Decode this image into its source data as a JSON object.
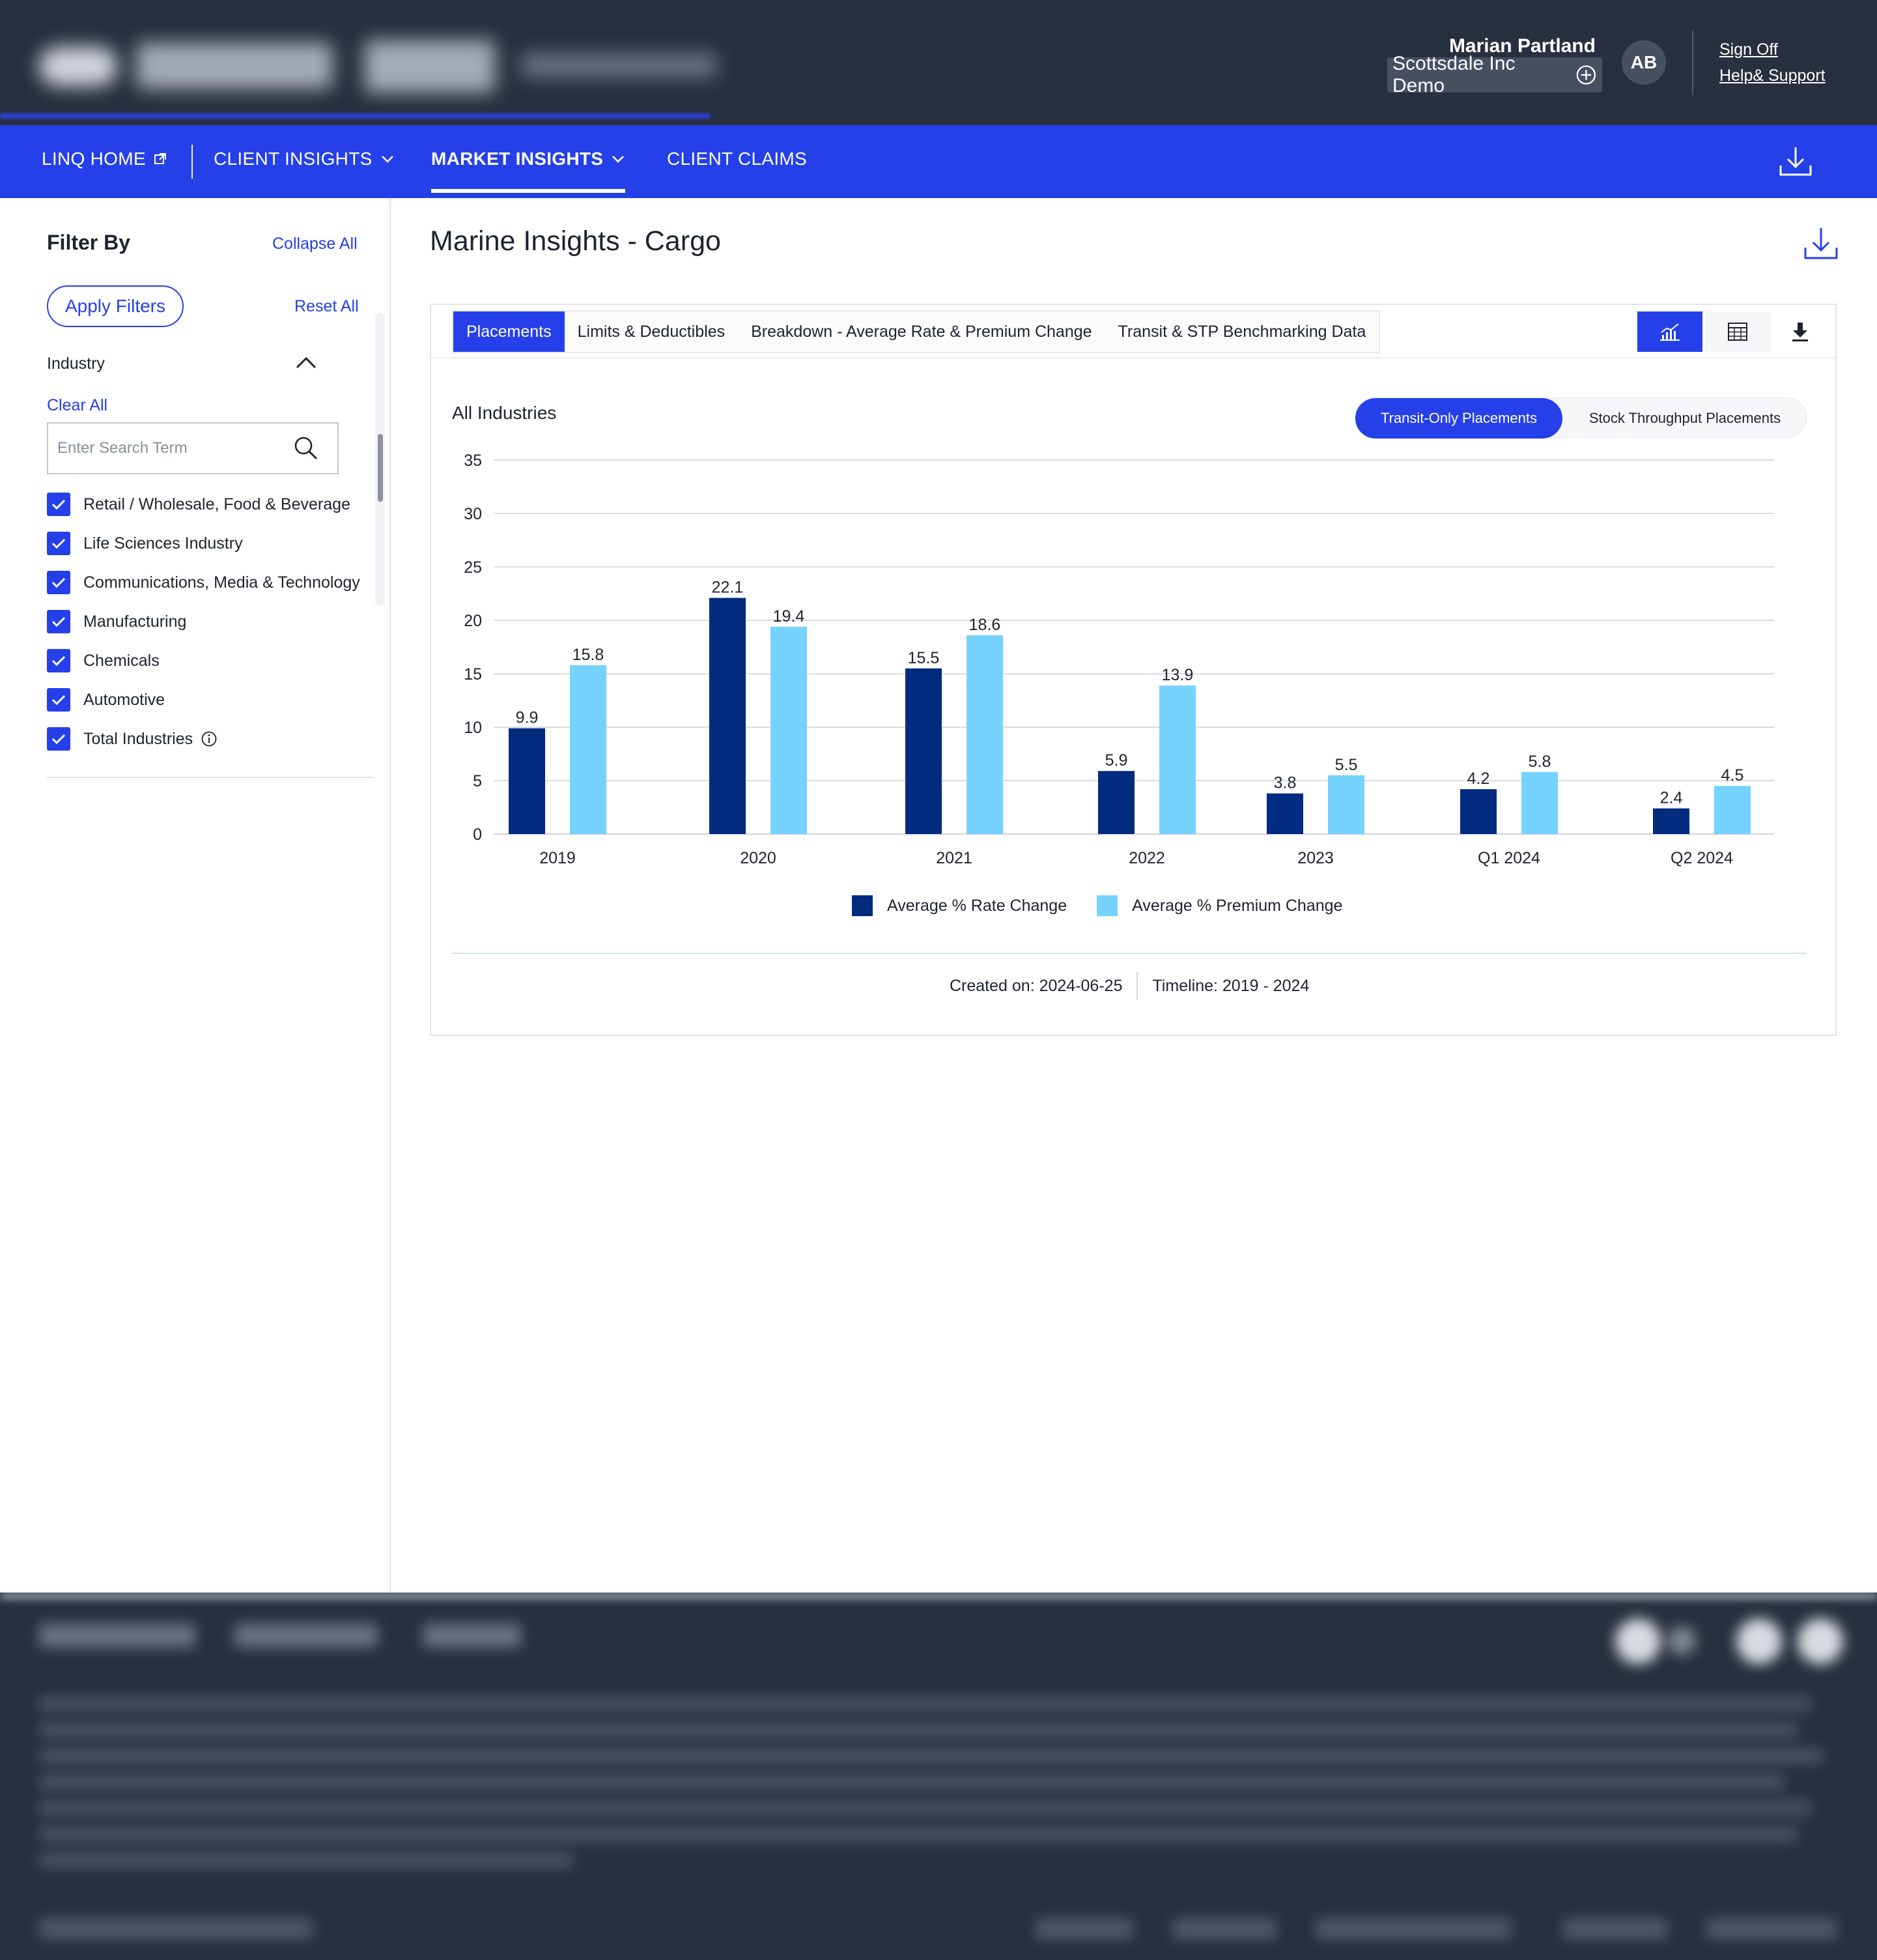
{
  "header": {
    "user_name": "Marian Partland",
    "client_name": "Scottsdale Inc Demo",
    "avatar_initials": "AB",
    "sign_off": "Sign Off",
    "help_support": "Help& Support"
  },
  "nav": {
    "items": [
      {
        "label": "LINQ HOME",
        "icon": "external-link-icon"
      },
      {
        "label": "CLIENT INSIGHTS",
        "icon": "chevron-down-icon"
      },
      {
        "label": "MARKET INSIGHTS",
        "icon": "chevron-down-icon",
        "active": true
      },
      {
        "label": "CLIENT CLAIMS"
      }
    ],
    "download_icon": "download-icon"
  },
  "sidebar": {
    "title": "Filter By",
    "collapse_all": "Collapse All",
    "apply_filters": "Apply Filters",
    "reset_all": "Reset All",
    "section_label": "Industry",
    "clear_all": "Clear All",
    "search_placeholder": "Enter Search Term",
    "industries": [
      {
        "label": "Retail / Wholesale, Food & Beverage",
        "checked": true
      },
      {
        "label": "Life Sciences Industry",
        "checked": true
      },
      {
        "label": "Communications, Media & Technology",
        "checked": true
      },
      {
        "label": "Manufacturing",
        "checked": true
      },
      {
        "label": "Chemicals",
        "checked": true
      },
      {
        "label": "Automotive",
        "checked": true
      },
      {
        "label": "Total Industries",
        "checked": true,
        "info_icon": true
      }
    ]
  },
  "main": {
    "title": "Marine Insights - Cargo",
    "tabs": [
      {
        "label": "Placements",
        "active": true
      },
      {
        "label": "Limits & Deductibles"
      },
      {
        "label": "Breakdown - Average Rate & Premium Change"
      },
      {
        "label": "Transit & STP Benchmarking Data"
      }
    ],
    "tools": [
      "chart-view-icon",
      "table-view-icon",
      "download-icon"
    ],
    "subtitle": "All Industries",
    "toggle": {
      "on": "Transit-Only Placements",
      "off": "Stock Throughput Placements"
    },
    "created_on": "Created on: 2024-06-25",
    "timeline": "Timeline: 2019 - 2024"
  },
  "colors": {
    "accent": "#2540e8",
    "header_bg": "#28303f",
    "rate_series": "#002b7f",
    "premium_series": "#76d2ff"
  },
  "chart_data": {
    "type": "bar",
    "categories": [
      "2019",
      "2020",
      "2021",
      "2022",
      "2023",
      "Q1 2024",
      "Q2 2024"
    ],
    "series": [
      {
        "name": "Average % Rate Change",
        "values": [
          9.9,
          22.1,
          15.5,
          5.9,
          3.8,
          4.2,
          2.4
        ]
      },
      {
        "name": "Average % Premium Change",
        "values": [
          15.8,
          19.4,
          18.6,
          13.9,
          5.5,
          5.8,
          4.5
        ]
      }
    ],
    "yticks": [
      0,
      5,
      10,
      15,
      20,
      25,
      30,
      35
    ],
    "ylim": [
      0,
      35
    ],
    "grid": true,
    "legend": "bottom-center",
    "title": "All Industries",
    "xlabel": "",
    "ylabel": ""
  }
}
